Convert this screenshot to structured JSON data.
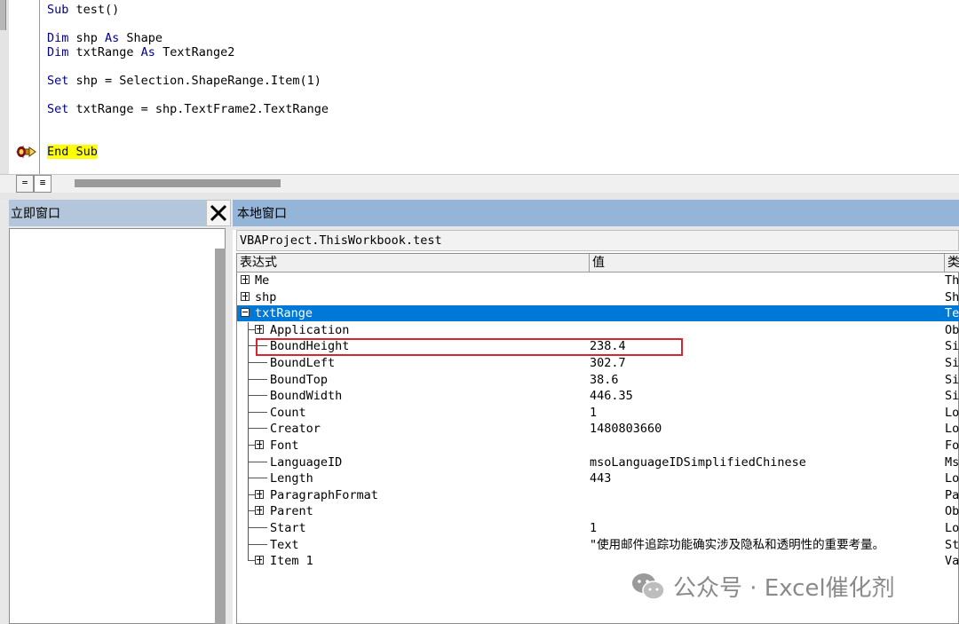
{
  "code": {
    "lines": [
      {
        "kw": "Sub",
        "text": " test()"
      },
      {
        "kw": "Dim",
        "text": " shp ",
        "kw2": "As",
        "text2": " Shape"
      },
      {
        "kw": "Dim",
        "text": " txtRange ",
        "kw2": "As",
        "text2": " TextRange2"
      },
      {
        "kw": "Set",
        "text": " shp = Selection.ShapeRange.Item(1)"
      },
      {
        "kw": "Set",
        "text": " txtRange = shp.TextFrame2.TextRange"
      },
      {
        "current": "End Sub"
      }
    ]
  },
  "immediate": {
    "title": "立即窗口",
    "close_glyph": "✕"
  },
  "locals": {
    "title": "本地窗口",
    "context": "VBAProject.ThisWorkbook.test",
    "headers": [
      "表达式",
      "值",
      "类"
    ],
    "rows": [
      {
        "expr": "Me",
        "value": "",
        "type": "Th"
      },
      {
        "expr": "shp",
        "value": "",
        "type": "Sh"
      },
      {
        "expr": "txtRange",
        "value": "",
        "type": "Te"
      },
      {
        "expr": "Application",
        "value": "",
        "type": "Ob"
      },
      {
        "expr": "BoundHeight",
        "value": "238.4",
        "type": "Si"
      },
      {
        "expr": "BoundLeft",
        "value": "302.7",
        "type": "Si"
      },
      {
        "expr": "BoundTop",
        "value": "38.6",
        "type": "Si"
      },
      {
        "expr": "BoundWidth",
        "value": "446.35",
        "type": "Si"
      },
      {
        "expr": "Count",
        "value": "1",
        "type": "Lo"
      },
      {
        "expr": "Creator",
        "value": "1480803660",
        "type": "Lo"
      },
      {
        "expr": "Font",
        "value": "",
        "type": "Fo"
      },
      {
        "expr": "LanguageID",
        "value": "msoLanguageIDSimplifiedChinese",
        "type": "Ms"
      },
      {
        "expr": "Length",
        "value": "443",
        "type": "Lo"
      },
      {
        "expr": "ParagraphFormat",
        "value": "",
        "type": "Pa"
      },
      {
        "expr": "Parent",
        "value": "",
        "type": "Ob"
      },
      {
        "expr": "Start",
        "value": "1",
        "type": "Lo"
      },
      {
        "expr": "Text",
        "value": "\"使用邮件追踪功能确实涉及隐私和透明性的重要考量。 ",
        "type": "St"
      },
      {
        "expr": "Item 1",
        "value": "",
        "type": "Va"
      }
    ]
  },
  "watermark": {
    "text": "公众号 · Excel催化剂"
  },
  "colors": {
    "keyword": "#00008b",
    "selection": "#0078d7",
    "highlight": "#ffff00",
    "redbox": "#d9262c"
  }
}
